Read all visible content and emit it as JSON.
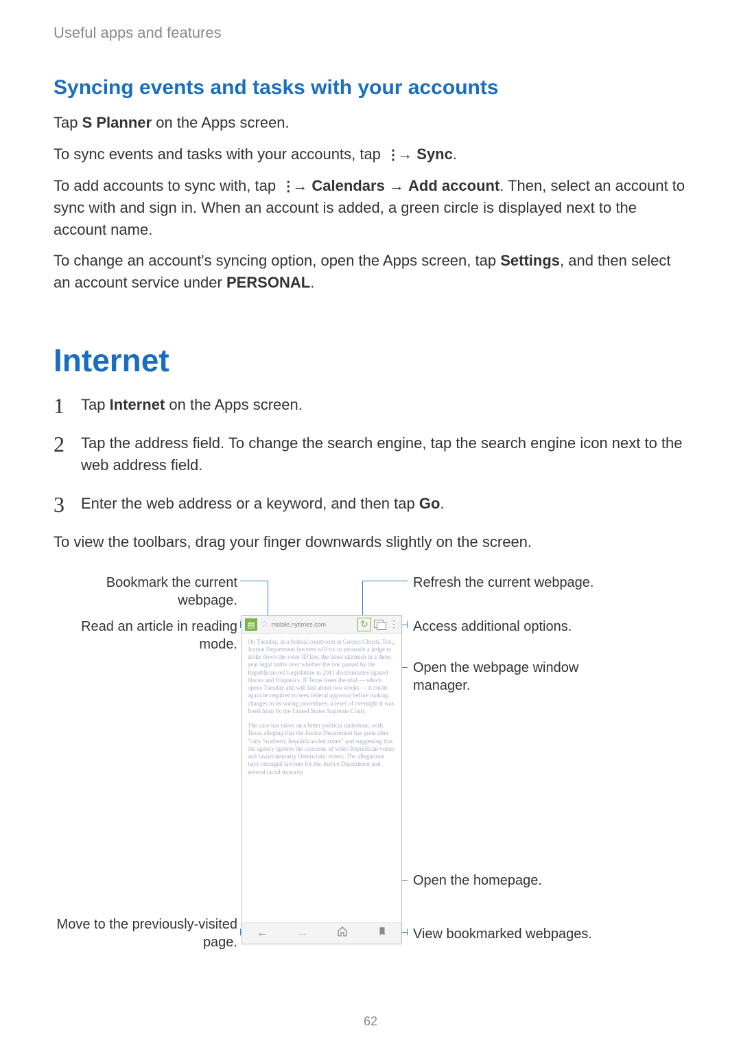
{
  "breadcrumb": "Useful apps and features",
  "page_number": "62",
  "section1": {
    "heading": "Syncing events and tasks with your accounts",
    "p1_pre": "Tap ",
    "p1_bold": "S Planner",
    "p1_post": " on the Apps screen.",
    "p2_pre": "To sync events and tasks with your accounts, tap ",
    "p2_arrow": " → ",
    "p2_bold": "Sync",
    "p2_post": ".",
    "p3_pre": "To add accounts to sync with, tap ",
    "p3_arrow1": " → ",
    "p3_bold1": "Calendars",
    "p3_arrow2": " → ",
    "p3_bold2": "Add account",
    "p3_post": ". Then, select an account to sync with and sign in. When an account is added, a green circle is displayed next to the account name.",
    "p4_pre": "To change an account's syncing option, open the Apps screen, tap ",
    "p4_bold1": "Settings",
    "p4_mid": ", and then select an account service under ",
    "p4_bold2": "PERSONAL",
    "p4_post": "."
  },
  "section2": {
    "heading": "Internet",
    "steps": {
      "s1_pre": "Tap ",
      "s1_bold": "Internet",
      "s1_post": " on the Apps screen.",
      "s2": "Tap the address field. To change the search engine, tap the search engine icon next to the web address field.",
      "s3_pre": "Enter the web address or a keyword, and then tap ",
      "s3_bold": "Go",
      "s3_post": "."
    },
    "after_steps": "To view the toolbars, drag your finger downwards slightly on the screen."
  },
  "diagram": {
    "bookmark": "Bookmark the current webpage.",
    "reading_mode": "Read an article in reading mode.",
    "prev_page": "Move to the previously-visited page.",
    "refresh": "Refresh the current webpage.",
    "additional": "Access additional options.",
    "window_mgr": "Open the webpage window manager.",
    "homepage": "Open the homepage.",
    "bookmarks": "View bookmarked webpages.",
    "phone": {
      "reader_icon": "▤",
      "star": "☆",
      "url": "mobile.nytimes.com",
      "refresh_icon": "↻",
      "menu_icon": "⋮",
      "article_p1": "On Tuesday, in a federal courtroom in Corpus Christi, Tex., Justice Department lawyers will try to persuade a judge to strike down the voter ID law, the latest skirmish in a three-year legal battle over whether the law passed by the Republican-led Legislature in 2011 discriminates against blacks and Hispanics. If Texas loses the trial — which opens Tuesday and will last about two weeks — it could again be required to seek federal approval before making changes to its voting procedures, a level of oversight it was freed from by the United States Supreme Court.",
      "article_p2": "The case has taken on a bitter political undertone, with Texas alleging that the Justice Department has gone after \"only Southern, Republican-led states\" and suggesting that the agency ignores the concerns of white Republican voters and favors minority Democratic voters. The allegations have outraged lawyers for the Justice Department and several racial minority",
      "back_icon": "←",
      "forward_icon": "→",
      "home_icon_accessible": "Home",
      "bookmark_icon_accessible": "Bookmarks"
    }
  }
}
